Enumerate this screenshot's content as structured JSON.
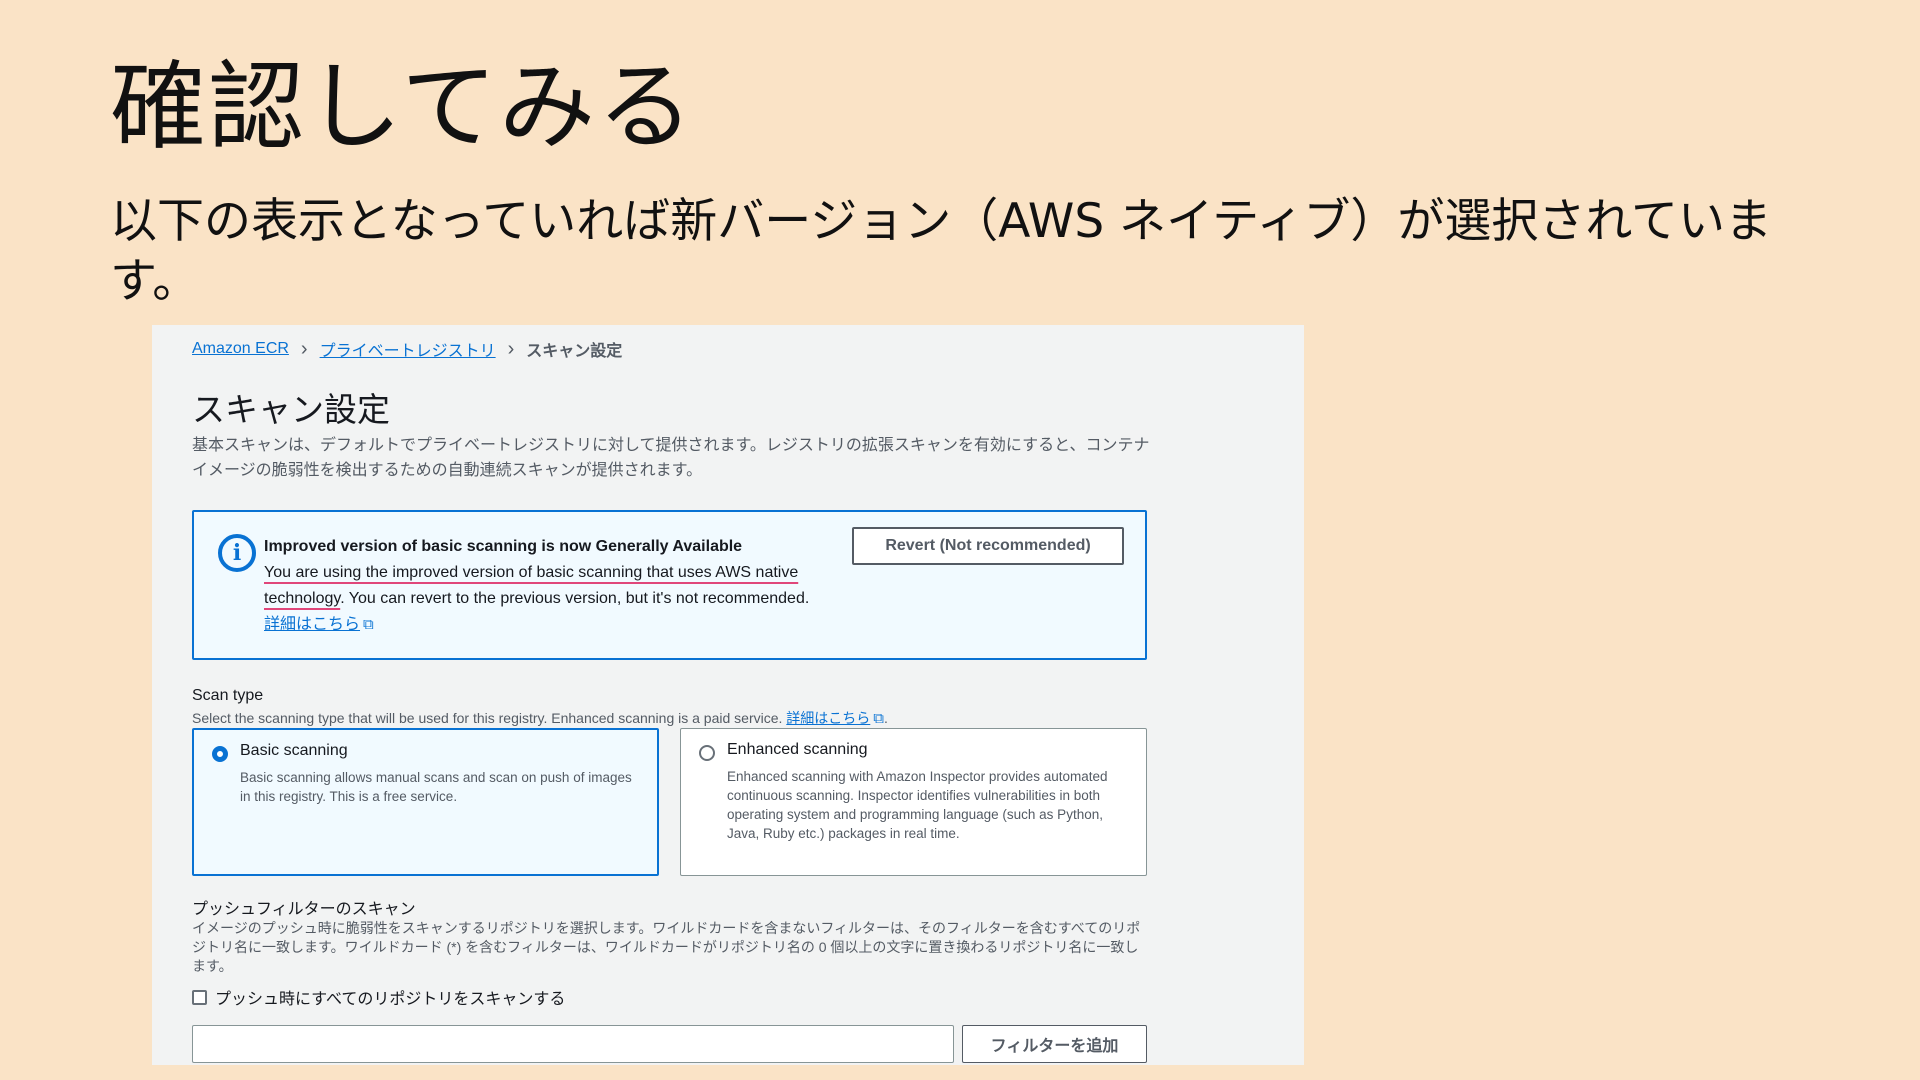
{
  "slide": {
    "title": "確認してみる",
    "subtitle": "以下の表示となっていれば新バージョン（AWS ネイティブ）が選択されています。"
  },
  "breadcrumb": {
    "items": [
      "Amazon ECR",
      "プライベートレジストリ"
    ],
    "current": "スキャン設定",
    "separator": "›"
  },
  "page": {
    "title": "スキャン設定",
    "description": "基本スキャンは、デフォルトでプライベートレジストリに対して提供されます。レジストリの拡張スキャンを有効にすると、コンテナイメージの脆弱性を検出するための自動連続スキャンが提供されます。"
  },
  "info_box": {
    "icon_glyph": "i",
    "heading": "Improved version of basic scanning is now Generally Available",
    "text_underlined": "You are using the improved version of basic scanning that uses AWS native technology",
    "text_rest": ". You can revert to the previous version, but it's not recommended.",
    "link": "詳細はこちら",
    "revert_button": "Revert (Not recommended)"
  },
  "scan_type": {
    "label": "Scan type",
    "description": "Select the scanning type that will be used for this registry. Enhanced scanning is a paid service.",
    "link": "詳細はこちら",
    "period": ".",
    "options": [
      {
        "title": "Basic scanning",
        "description": "Basic scanning allows manual scans and scan on push of images in this registry. This is a free service.",
        "selected": true
      },
      {
        "title": "Enhanced scanning",
        "description": "Enhanced scanning with Amazon Inspector provides automated continuous scanning. Inspector identifies vulnerabilities in both operating system and programming language (such as Python, Java, Ruby etc.) packages in real time.",
        "selected": false
      }
    ]
  },
  "push_filter": {
    "label": "プッシュフィルターのスキャン",
    "description": "イメージのプッシュ時に脆弱性をスキャンするリポジトリを選択します。ワイルドカードを含まないフィルターは、そのフィルターを含むすべてのリポジトリ名に一致します。ワイルドカード (*) を含むフィルターは、ワイルドカードがリポジトリ名の 0 個以上の文字に置き換わるリポジトリ名に一致します。",
    "checkbox_label": "プッシュ時にすべてのリポジトリをスキャンする",
    "input_value": "",
    "add_button": "フィルターを追加"
  },
  "icons": {
    "info": "info-circle-icon",
    "external": "external-link-icon",
    "separator": "chevron-right-icon"
  },
  "colors": {
    "background": "#fae3c6",
    "accent": "#0972d3",
    "underline": "#e0467a"
  }
}
